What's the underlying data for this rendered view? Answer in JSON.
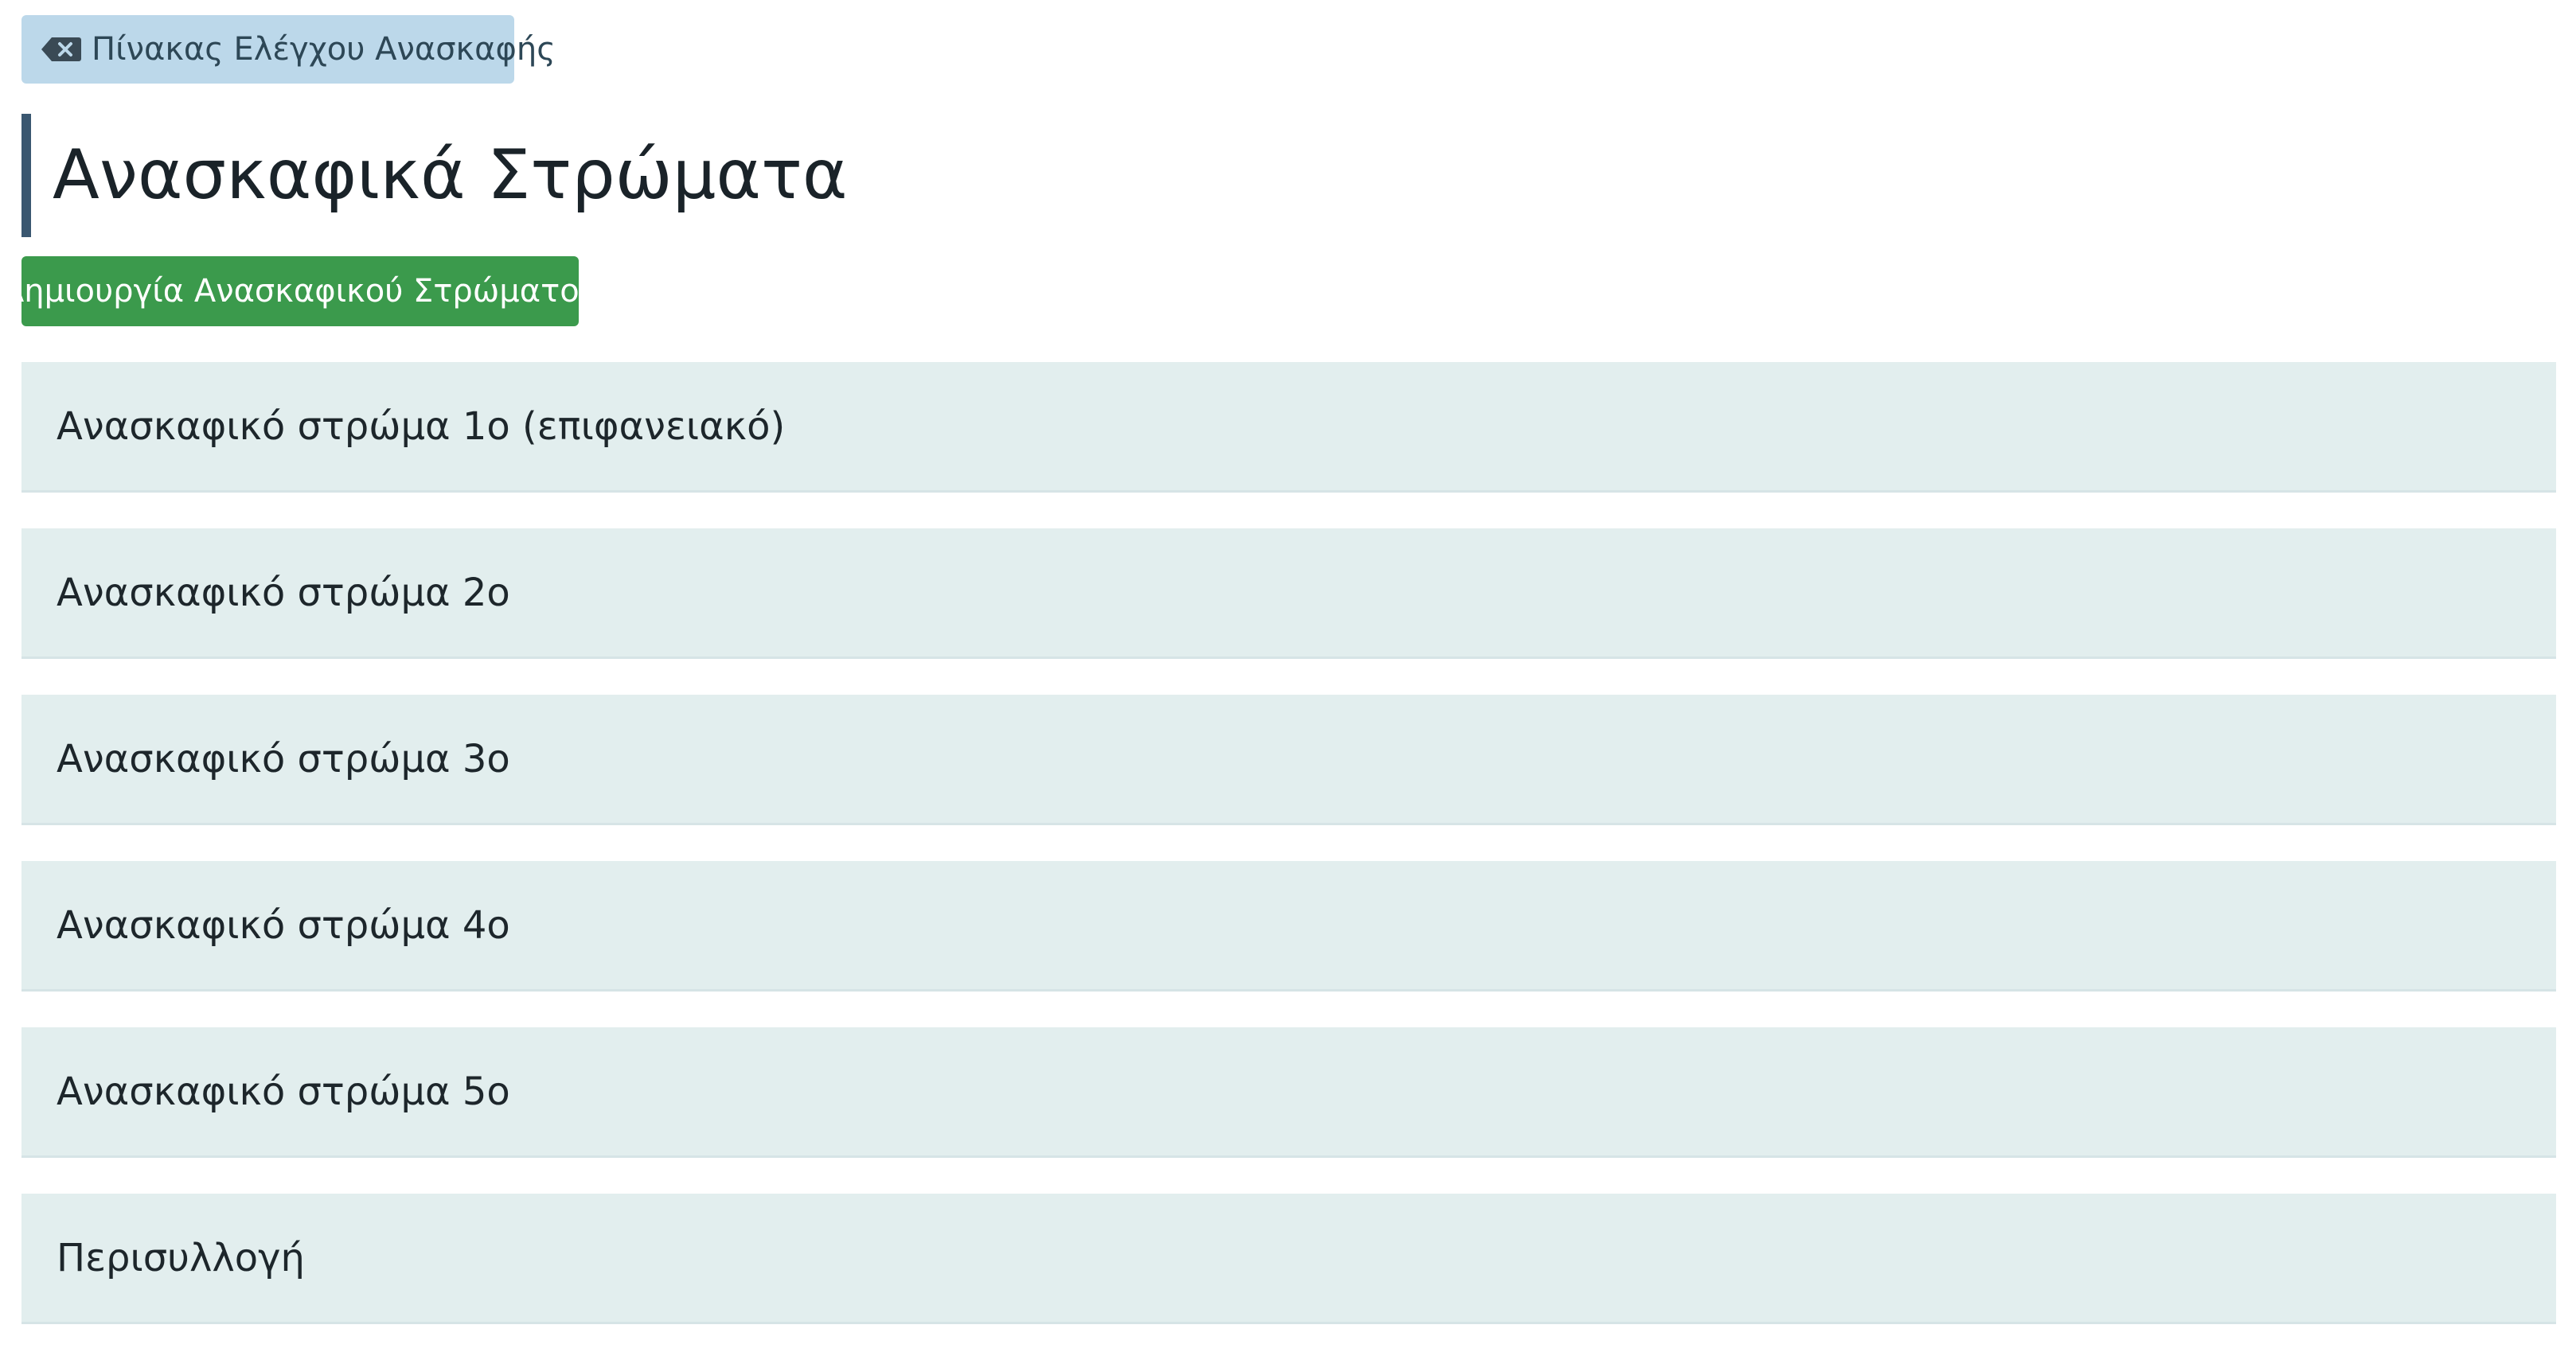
{
  "back_button": {
    "icon": "backspace-icon",
    "label": "Πίνακας Ελέγχου Ανασκαφής"
  },
  "page": {
    "title": "Ανασκαφικά Στρώματα"
  },
  "create_button": {
    "label": "Δημιουργία Ανασκαφικού Στρώματος",
    "color": "#3b9a4c"
  },
  "layers": [
    {
      "label": "Ανασκαφικό στρώμα 1ο (επιφανειακό)"
    },
    {
      "label": "Ανασκαφικό στρώμα 2ο"
    },
    {
      "label": "Ανασκαφικό στρώμα 3ο"
    },
    {
      "label": "Ανασκαφικό στρώμα 4ο"
    },
    {
      "label": "Ανασκαφικό στρώμα 5ο"
    },
    {
      "label": "Περισυλλογή"
    }
  ],
  "colors": {
    "back_button_bg": "#bcd8ea",
    "title_accent": "#3a5770",
    "list_item_bg": "#e2eeee"
  }
}
